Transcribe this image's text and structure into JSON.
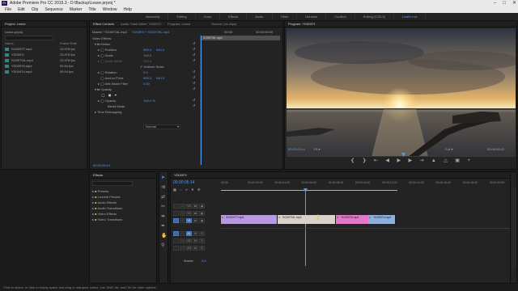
{
  "title_bar": {
    "app_icon": "Pr",
    "title": "Adobe Premiere Pro CC 2015.3 - D:\\Backup\\Leave.prproj *",
    "controls": [
      "minimize-icon",
      "maximize-icon",
      "close-icon"
    ]
  },
  "menu": [
    "File",
    "Edit",
    "Clip",
    "Sequence",
    "Marker",
    "Title",
    "Window",
    "Help"
  ],
  "workspaces": [
    {
      "label": "Assembly",
      "active": false
    },
    {
      "label": "Editing",
      "active": false
    },
    {
      "label": "Color",
      "active": false
    },
    {
      "label": "Effects",
      "active": false
    },
    {
      "label": "Audio",
      "active": false
    },
    {
      "label": "Titles",
      "active": false
    },
    {
      "label": "Libraries",
      "active": false
    },
    {
      "label": "CoolKrd",
      "active": false
    },
    {
      "label": "Editing (CS5.5)",
      "active": false
    },
    {
      "label": "LeaKrd ed",
      "active": true
    }
  ],
  "project": {
    "tab": "Project: Leave",
    "file": "Leave.prproj",
    "col_name": "Name",
    "col_rate": "Frame Rate",
    "items": [
      {
        "name": "SG0097T.mp4",
        "rate": "23.976 fps"
      },
      {
        "name": "YD0097t",
        "rate": "23.976 fps"
      },
      {
        "name": "SG0970tL.mp4",
        "rate": "23.976 fps"
      },
      {
        "name": "YD0097tt.mp4",
        "rate": "59.94 fps"
      },
      {
        "name": "YD0097d.mp4",
        "rate": "59.94 fps"
      }
    ]
  },
  "effect_controls": {
    "tabs": [
      {
        "label": "Effect Controls",
        "active": true
      },
      {
        "label": "Audio Track Mixer: YD0097t",
        "active": false
      },
      {
        "label": "Program: Leave",
        "active": false
      },
      {
        "label": "Source: (no clips)",
        "active": false
      }
    ],
    "master": "Master * SG0970tL.mp4",
    "master_seq": "YD0097t * SG0970tL.mp4",
    "mini_time_start": "00:00",
    "mini_time_end": "00:00:05:00",
    "mini_clip": "SG0970tL.mp4",
    "section_video": "Video Effects",
    "motion": "Motion",
    "position_label": "Position",
    "position_x": "959.3",
    "position_y": "540.0",
    "scale_label": "Scale",
    "scale_val": "100.0",
    "scale_width_label": "Scale Width",
    "scale_width_val": "100.0",
    "uniform_label": "Uniform Scale",
    "rotation_label": "Rotation",
    "rotation_val": "0.0",
    "anchor_label": "Anchor Point",
    "anchor_x": "959.3",
    "anchor_y": "540.0",
    "flicker_label": "Anti-flicker Filter",
    "flicker_val": "0.00",
    "opacity_section": "Opacity",
    "opacity_label": "Opacity",
    "opacity_val": "100.0 %",
    "blend_label": "Blend Mode",
    "blend_val": "Normal",
    "time_remap": "Time Remapping",
    "timecode": "00:00:05:14"
  },
  "program": {
    "tab": "Program: YD0097t",
    "timecode": "00:00:05:14",
    "fit": "Fit",
    "quality": "Full",
    "duration": "00:00:09:22"
  },
  "effects_panel": {
    "tab": "Effects",
    "items": [
      "Presets",
      "Lumetri Presets",
      "Audio Effects",
      "Audio Transitions",
      "Video Effects",
      "Video Transitions"
    ]
  },
  "timeline": {
    "tab": "YD0097t",
    "timecode": "00:00:05:14",
    "ruler": [
      "00:00",
      "00:00:02:00",
      "00:00:04:00",
      "00:00:06:00",
      "00:00:08:00",
      "00:00:10:00",
      "00:00:12:00",
      "00:00:14:00",
      "00:00:16:00",
      "00:00:18:00",
      "00:00:20:00"
    ],
    "tracks_video": [
      "V3",
      "V2",
      "V1"
    ],
    "tracks_audio": [
      "A1",
      "A2",
      "A3"
    ],
    "master_label": "Master",
    "master_val": "0.0",
    "clips": [
      {
        "name": "SG0097T.mp4",
        "color": "#b79ae0"
      },
      {
        "name": "SG0970tL.mp4",
        "color": "#d9d2c8"
      },
      {
        "name": "YD0097tt.mp4",
        "color": "#e07ac8"
      },
      {
        "name": "YD0097d.mp4",
        "color": "#8fb0dc"
      }
    ]
  },
  "status": "Click to select, or click in empty space and drag to marquee select. Use Shift, Alt, and Ctrl for other options.",
  "colors": {
    "accent": "#4f9cf0",
    "playhead": "#4f9cf0",
    "work_area": "#c9b94a"
  }
}
